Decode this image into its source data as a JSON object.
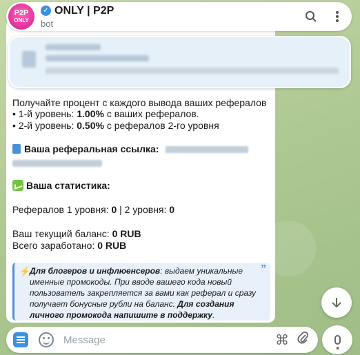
{
  "header": {
    "avatar_line1": "P2P",
    "avatar_line2": "ONLY",
    "title": "ONLY | P2P",
    "subtitle": "bot",
    "search_icon": "search-icon",
    "menu_icon": "more-vertical-icon"
  },
  "message": {
    "intro": "Получайте процент с каждого вывода ваших рефералов",
    "level1_prefix": "• 1-й уровень: ",
    "level1_value": "1.00%",
    "level1_suffix": " с ваших рефералов.",
    "level2_prefix": "• 2-й уровень: ",
    "level2_value": "0.50%",
    "level2_suffix": " с рефералов 2-го уровня",
    "ref_link_label": "Ваша реферальная ссылка:",
    "stats_label": "Ваша статистика:",
    "referrals_prefix": "Рефералов 1 уровня: ",
    "referrals_l1": "0",
    "referrals_sep": " | 2 уровня: ",
    "referrals_l2": "0",
    "balance_prefix": "Ваш текущий баланс: ",
    "balance_value": "0 RUB",
    "earned_prefix": "Всего заработано: ",
    "earned_value": "0 RUB"
  },
  "quote": {
    "bold1": "Для блогеров и инфлюенсеров",
    "text1": ": выдаем уникальные именные промокоды. При вводе вашего кода новый пользователь закрепляется за вами как реферал и сразу получает бонусные рубли на баланс. ",
    "bold2": "Для создания личного промокода напишите в поддержку",
    "text2": "."
  },
  "composer": {
    "placeholder": "Message"
  },
  "colors": {
    "accent": "#3d8fe0",
    "quote_border": "#4a90d9",
    "avatar": "#d31d8d"
  }
}
